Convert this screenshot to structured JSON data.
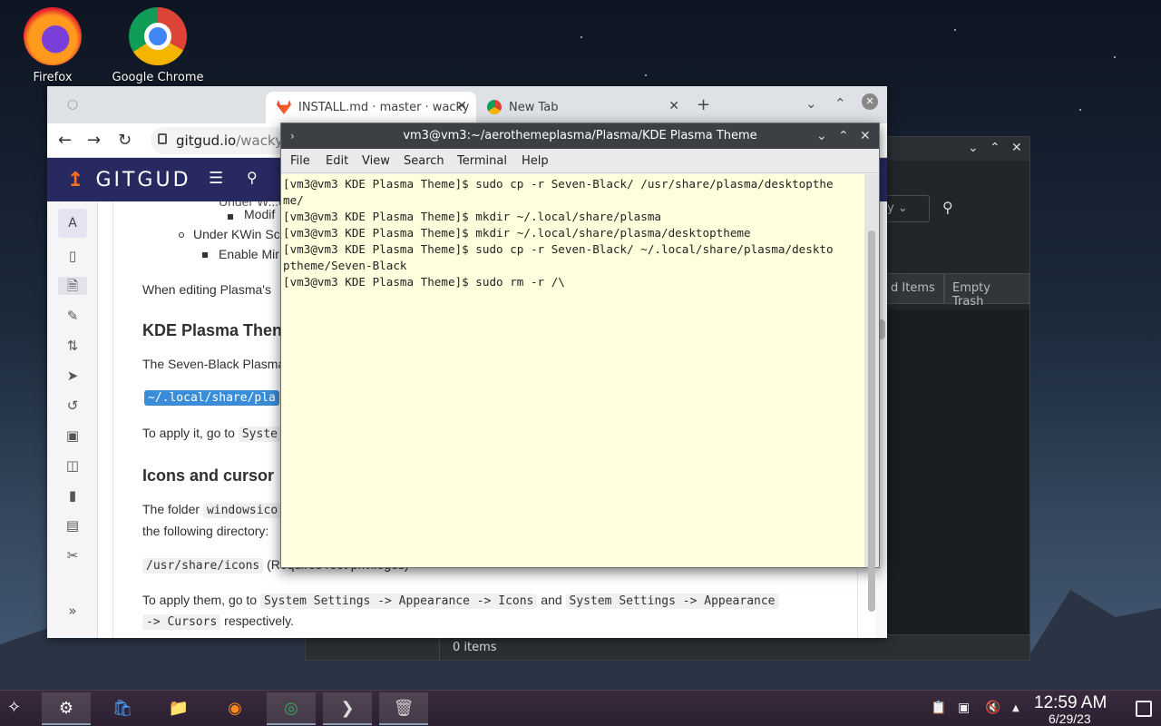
{
  "desktop": {
    "icons": [
      {
        "label": "Firefox",
        "icon": "firefox-icon"
      },
      {
        "label": "Google Chrome",
        "icon": "chrome-icon"
      }
    ]
  },
  "dolphin": {
    "search_value": "y",
    "buttons": [
      "d Items",
      "Empty Trash"
    ],
    "status": "0 items"
  },
  "browser": {
    "tabs": [
      {
        "title": "INSTALL.md · master · wacky",
        "icon": "gitlab-icon",
        "active": true
      },
      {
        "title": "New Tab",
        "icon": "chrome-icon",
        "active": false
      }
    ],
    "url_host": "gitgud.io",
    "url_path": "/wackyid",
    "site_logo": "GITGUD",
    "sidebar_avatar": "A"
  },
  "doc": {
    "line_nested_1": "Modif",
    "line_kwin": "Under KWin Sc",
    "line_enable": "Enable Mir",
    "line_partial_top": "Under W...e",
    "para_editing": "When editing Plasma's",
    "h_kde": "KDE Plasma Then",
    "para_seven": "The Seven-Black Plasma",
    "code_path": "~/.local/share/pla",
    "para_apply_prefix": "To apply it, go to",
    "code_system": "Syste",
    "h_icons": "Icons and cursor",
    "para_folder_prefix": "The folder",
    "code_windowsico": "windowsico",
    "para_following": "the following directory:",
    "code_usr_icons": "/usr/share/icons",
    "usr_icons_suffix": "(Requires root privileges)",
    "apply_them_prefix": "To apply them, go to",
    "code_icons_path": "System Settings -> Appearance -> Icons",
    "and_text": "and",
    "code_cursors_path": "System Settings -> Appearance",
    "code_cursors_tail": "-> Cursors",
    "respectively": "respectively."
  },
  "terminal": {
    "title": "vm3@vm3:~/aerothemeplasma/Plasma/KDE Plasma Theme",
    "menu": [
      "File",
      "Edit",
      "View",
      "Search",
      "Terminal",
      "Help"
    ],
    "output": "[vm3@vm3 KDE Plasma Theme]$ sudo cp -r Seven-Black/ /usr/share/plasma/desktopthe\nme/\n[vm3@vm3 KDE Plasma Theme]$ mkdir ~/.local/share/plasma\n[vm3@vm3 KDE Plasma Theme]$ mkdir ~/.local/share/plasma/desktoptheme\n[vm3@vm3 KDE Plasma Theme]$ sudo cp -r Seven-Black/ ~/.local/share/plasma/deskto\nptheme/Seven-Black\n[vm3@vm3 KDE Plasma Theme]$ sudo rm -r /\\"
  },
  "taskbar": {
    "time": "12:59 AM",
    "date": "6/29/23"
  },
  "colors": {
    "terminal_bg": "#ffffdd",
    "gitgud_header": "#292961",
    "taskbar": "#2b1f30"
  }
}
